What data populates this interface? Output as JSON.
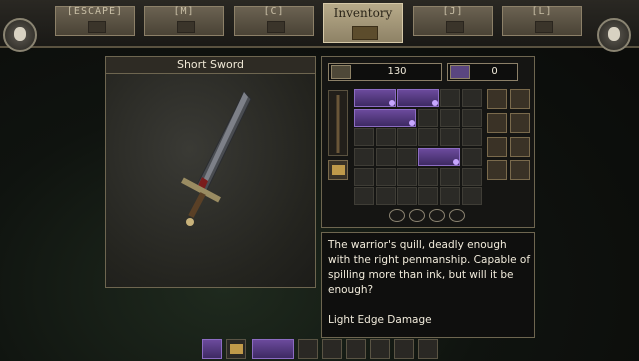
{
  "tabs": [
    {
      "key": "[ESCAPE]",
      "icon": "menu-icon"
    },
    {
      "key": "[M]",
      "icon": "map-icon"
    },
    {
      "key": "[C]",
      "icon": "character-icon"
    },
    {
      "key": "Inventory",
      "icon": "inventory-icon"
    },
    {
      "key": "[J]",
      "icon": "journal-icon"
    },
    {
      "key": "[L]",
      "icon": "lore-icon"
    }
  ],
  "item": {
    "title": "Short Sword",
    "description": "The warrior's quill, deadly enough with the right penmanship. Capable of spilling more than ink, but will it be enough?",
    "stat": "Light Edge Damage"
  },
  "currency": {
    "gold": "130",
    "gems": "0"
  },
  "colors": {
    "rarity_purple": "#6b4a9c",
    "frame_gold": "#8c8068"
  }
}
